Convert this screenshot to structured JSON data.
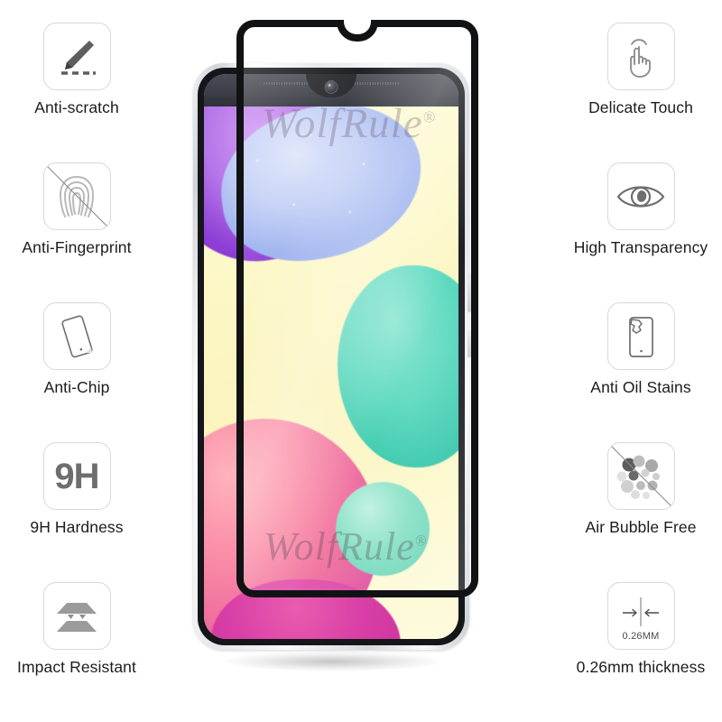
{
  "product": {
    "brand_watermark": "WolfRule",
    "brand_mark_symbol": "®"
  },
  "features_left": [
    {
      "label": "Anti-scratch",
      "icon": "pencil-scratch-icon"
    },
    {
      "label": "Anti-Fingerprint",
      "icon": "fingerprint-slash-icon"
    },
    {
      "label": "Anti-Chip",
      "icon": "tilted-phone-icon"
    },
    {
      "label": "9H Hardness",
      "icon": "nine-h-icon",
      "icon_text": "9H"
    },
    {
      "label": "Impact Resistant",
      "icon": "layered-plates-icon"
    }
  ],
  "features_right": [
    {
      "label": "Delicate Touch",
      "icon": "tap-hand-icon"
    },
    {
      "label": "High Transparency",
      "icon": "eye-icon"
    },
    {
      "label": "Anti Oil Stains",
      "icon": "phone-oil-stain-icon"
    },
    {
      "label": "Air Bubble Free",
      "icon": "bubbles-slash-icon"
    },
    {
      "label": "0.26mm thickness",
      "icon": "thickness-arrows-icon",
      "icon_text": "0.26MM"
    }
  ],
  "colors": {
    "icon_border": "#d8d8d8",
    "label_text": "#1c1c1c",
    "icon_gray": "#8a8a8a",
    "nine_h_gray": "#6e6e6e",
    "glass_border": "#111214",
    "wallpaper_yellow": "#fdf8c8",
    "blob_purple": "#8f3fd6",
    "blob_blue": "#9db2ef",
    "blob_teal": "#2ec5a8",
    "blob_pink": "#ef6f9e",
    "blob_mint": "#86e0c5",
    "blob_magenta": "#d93fa6"
  }
}
